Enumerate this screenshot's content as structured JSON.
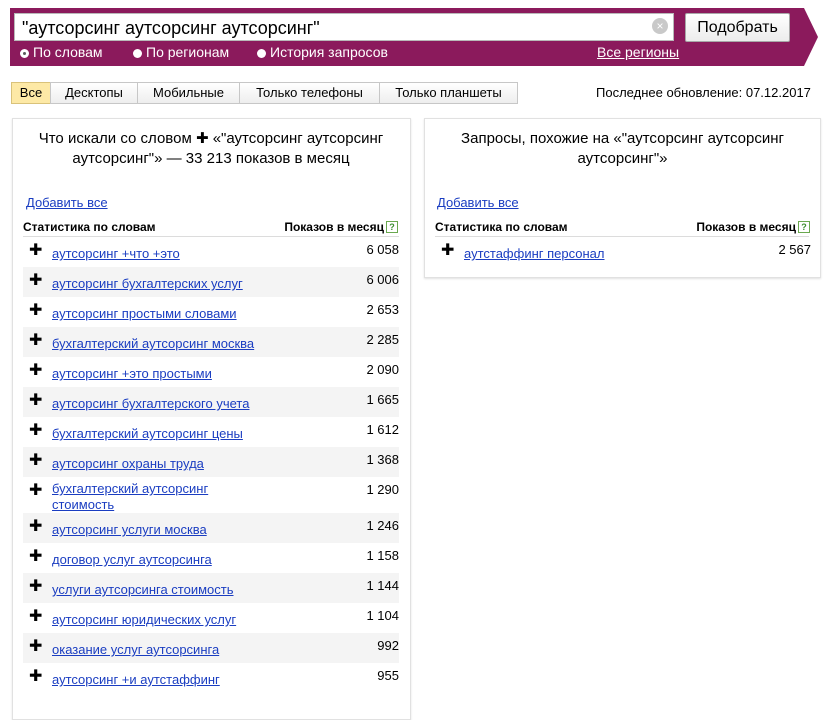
{
  "search": {
    "query": "\"аутсорсинг аутсорсинг аутсорсинг\"",
    "submit_label": "Подобрать",
    "clear_icon": "×",
    "options": [
      {
        "label": "По словам",
        "checked": true
      },
      {
        "label": "По регионам",
        "checked": false
      },
      {
        "label": "История запросов",
        "checked": false
      }
    ],
    "regions_link": "Все регионы"
  },
  "tabs": [
    {
      "label": "Все",
      "active": true
    },
    {
      "label": "Десктопы",
      "active": false
    },
    {
      "label": "Мобильные",
      "active": false
    },
    {
      "label": "Только телефоны",
      "active": false
    },
    {
      "label": "Только планшеты",
      "active": false
    }
  ],
  "last_update": "Последнее обновление: 07.12.2017",
  "left_panel": {
    "title_prefix": "Что искали со словом",
    "title_plus": "✚",
    "title_rest": "«\"аутсорсинг аутсорсинг аутсорсинг\"» — 33 213 показов в месяц",
    "add_all": "Добавить все",
    "col_left": "Статистика по словам",
    "col_right": "Показов в месяц",
    "help": "?",
    "rows": [
      {
        "phrase": "аутсорсинг +что +это",
        "count": "6 058"
      },
      {
        "phrase": "аутсорсинг бухгалтерских услуг",
        "count": "6 006"
      },
      {
        "phrase": "аутсорсинг простыми словами",
        "count": "2 653"
      },
      {
        "phrase": "бухгалтерский аутсорсинг москва",
        "count": "2 285"
      },
      {
        "phrase": "аутсорсинг +это простыми",
        "count": "2 090"
      },
      {
        "phrase": "аутсорсинг бухгалтерского учета",
        "count": "1 665"
      },
      {
        "phrase": "бухгалтерский аутсорсинг цены",
        "count": "1 612"
      },
      {
        "phrase": "аутсорсинг охраны труда",
        "count": "1 368"
      },
      {
        "phrase": "бухгалтерский аутсорсинг стоимость",
        "count": "1 290"
      },
      {
        "phrase": "аутсорсинг услуги москва",
        "count": "1 246"
      },
      {
        "phrase": "договор услуг аутсорсинга",
        "count": "1 158"
      },
      {
        "phrase": "услуги аутсорсинга стоимость",
        "count": "1 144"
      },
      {
        "phrase": "аутсорсинг юридических услуг",
        "count": "1 104"
      },
      {
        "phrase": "оказание услуг аутсорсинга",
        "count": "992"
      },
      {
        "phrase": "аутсорсинг +и аутстаффинг",
        "count": "955"
      }
    ]
  },
  "right_panel": {
    "title": "Запросы, похожие на «\"аутсорсинг аутсорсинг аутсорсинг\"»",
    "add_all": "Добавить все",
    "col_left": "Статистика по словам",
    "col_right": "Показов в месяц",
    "help": "?",
    "rows": [
      {
        "phrase": "аутстаффинг персонал",
        "count": "2 567"
      }
    ]
  },
  "row_plus": "✚",
  "colors": {
    "header_bg": "#8b1a5c",
    "link": "#1a3dc1",
    "active_tab": "#fde9a6",
    "row_alt": "#f4f4f4"
  }
}
